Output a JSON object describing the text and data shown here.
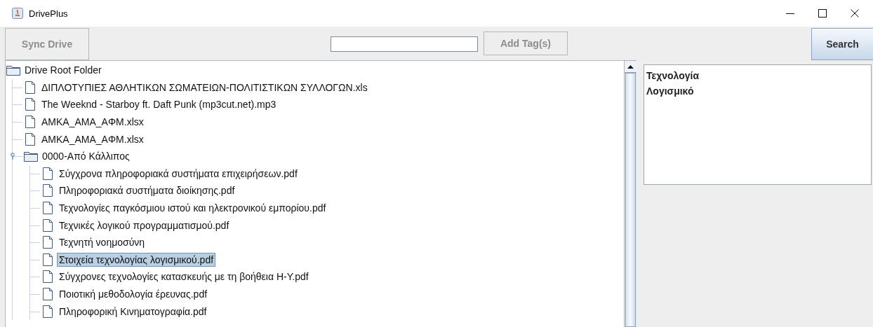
{
  "window": {
    "title": "DrivePlus"
  },
  "toolbar": {
    "sync_button": "Sync Drive",
    "add_tag_button": "Add Tag(s)",
    "search_button": "Search"
  },
  "tree": {
    "nodes": [
      {
        "kind": "folder",
        "label": "Drive Root Folder",
        "selected": false,
        "children": [
          {
            "kind": "file",
            "label": "ΔΙΠΛΟΤΥΠΙΕΣ ΑΘΛΗΤΙΚΩΝ ΣΩΜΑΤΕΙΩΝ-ΠΟΛΙΤΙΣΤΙΚΩΝ ΣΥΛΛΟΓΩΝ.xls",
            "selected": false
          },
          {
            "kind": "file",
            "label": "The Weeknd - Starboy ft. Daft Punk (mp3cut.net).mp3",
            "selected": false
          },
          {
            "kind": "file",
            "label": "AMKA_AMA_AΦM.xlsx",
            "selected": false
          },
          {
            "kind": "file",
            "label": "AMKA_AMA_AΦM.xlsx",
            "selected": false
          },
          {
            "kind": "folder",
            "label": "0000-Από Κάλλιπος",
            "selected": false,
            "expanded": true,
            "children": [
              {
                "kind": "file",
                "label": "Σύγχρονα πληροφοριακά συστήματα επιχειρήσεων.pdf",
                "selected": false
              },
              {
                "kind": "file",
                "label": "Πληροφοριακά συστήματα διοίκησης.pdf",
                "selected": false
              },
              {
                "kind": "file",
                "label": "Τεχνολογίες παγκόσμιου ιστού και ηλεκτρονικού εμπορίου.pdf",
                "selected": false
              },
              {
                "kind": "file",
                "label": "Τεχνικές λογικού προγραμματισμού.pdf",
                "selected": false
              },
              {
                "kind": "file",
                "label": "Τεχνητή νοημοσύνη",
                "selected": false
              },
              {
                "kind": "file",
                "label": "Στοιχεία τεχνολογίας λογισμικού.pdf",
                "selected": true
              },
              {
                "kind": "file",
                "label": "Σύγχρονες τεχνολογίες κατασκευής με τη βοήθεια Η-Υ.pdf",
                "selected": false
              },
              {
                "kind": "file",
                "label": "Ποιοτική μεθοδολογία έρευνας.pdf",
                "selected": false
              },
              {
                "kind": "file",
                "label": "Πληροφορική Κινηματογραφία.pdf",
                "selected": false
              }
            ]
          }
        ]
      }
    ]
  },
  "tags": [
    "Τεχνολογία",
    "Λογισμικό"
  ]
}
